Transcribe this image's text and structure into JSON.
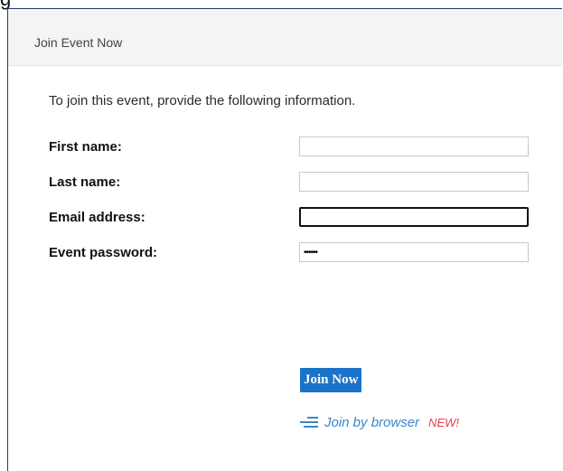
{
  "window": {
    "title": "Join Event Now"
  },
  "form": {
    "intro": "To join this event, provide the following information.",
    "fields": [
      {
        "label": "First name:",
        "value": "",
        "type": "text"
      },
      {
        "label": "Last name:",
        "value": "",
        "type": "text"
      },
      {
        "label": "Email address:",
        "value": "",
        "type": "text",
        "focused": true
      },
      {
        "label": "Event password:",
        "value": "••••••",
        "type": "password"
      }
    ]
  },
  "actions": {
    "join_label": "Join Now",
    "browser_label": "Join by browser",
    "new_badge": "NEW!",
    "browser_icon": "menu-lines-icon"
  },
  "colors": {
    "frame_border": "#1f3f74",
    "join_button": "#1a73c8",
    "link": "#3c86c6",
    "new_badge": "#e2414c"
  }
}
